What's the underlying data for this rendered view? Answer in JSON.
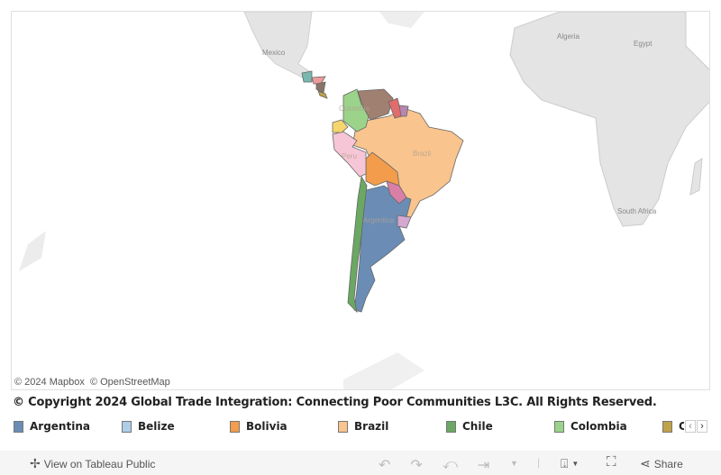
{
  "map": {
    "attribution": [
      "© 2024 Mapbox",
      "© OpenStreetMap"
    ],
    "place_labels": [
      "Mexico",
      "Algeria",
      "Egypt",
      "South Africa"
    ],
    "country_labels": [
      "Colombia",
      "Peru",
      "Brazil",
      "Argentina"
    ]
  },
  "copyright": "© Copyright 2024 Global Trade Integration: Connecting Poor Communities L3C. All Rights Reserved.",
  "legend": [
    {
      "label": "Argentina",
      "color": "#6b8db5"
    },
    {
      "label": "Belize",
      "color": "#aecde8"
    },
    {
      "label": "Bolivia",
      "color": "#f29c4c"
    },
    {
      "label": "Brazil",
      "color": "#f9c48d"
    },
    {
      "label": "Chile",
      "color": "#6aa863"
    },
    {
      "label": "Colombia",
      "color": "#9bd38a"
    },
    {
      "label": "C",
      "color": "#c0a24b"
    }
  ],
  "toolbar": {
    "view_label": "View on Tableau Public",
    "share_label": "Share"
  }
}
